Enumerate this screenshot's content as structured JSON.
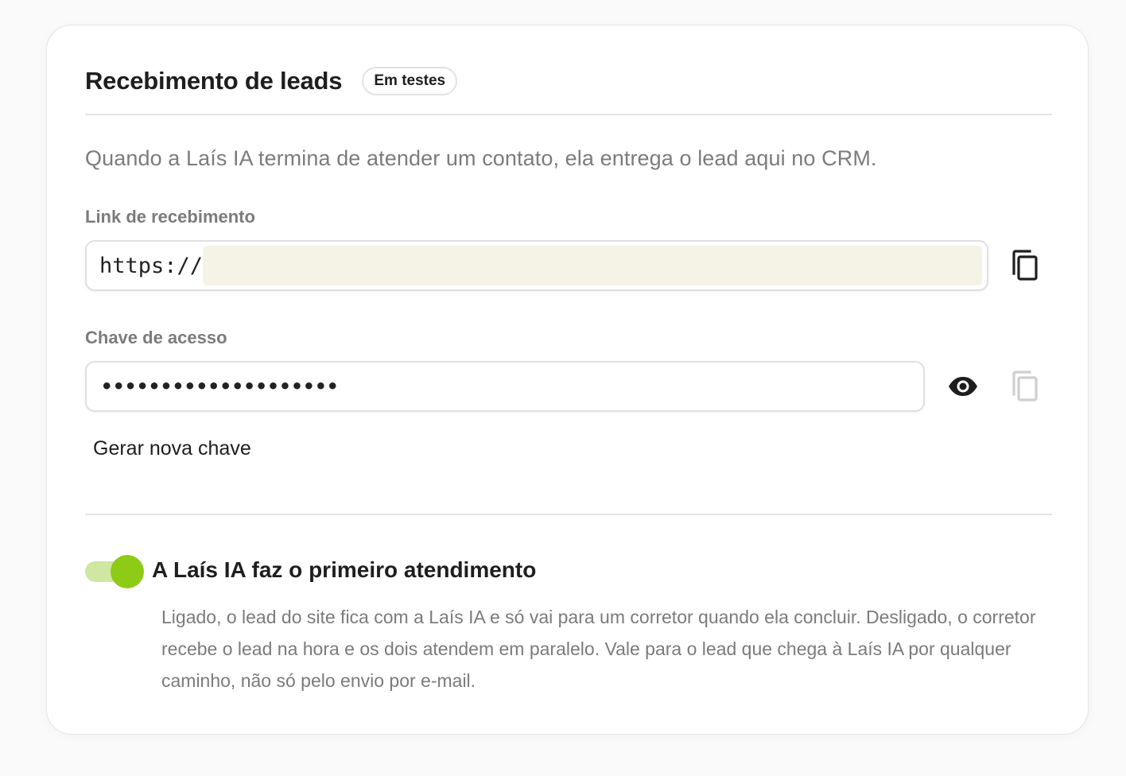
{
  "section": {
    "title": "Recebimento de leads",
    "badge": "Em testes",
    "description": "Quando a Laís IA termina de atender um contato, ela entrega o lead aqui no CRM."
  },
  "link_field": {
    "label": "Link de recebimento",
    "value_prefix": "https://",
    "copy_icon": "copy-icon"
  },
  "key_field": {
    "label": "Chave de acesso",
    "masked_value": "••••••••••••••••••••",
    "show_icon": "eye-icon",
    "copy_icon": "copy-icon",
    "copy_disabled": true
  },
  "actions": {
    "generate_key": "Gerar nova chave"
  },
  "ai_toggle": {
    "title": "A Laís IA faz o primeiro atendimento",
    "enabled": true,
    "description": "Ligado, o lead do site fica com a Laís IA e só vai para um corretor quando ela concluir. Desligado, o corretor recebe o lead na hora e os dois atendem em paralelo. Vale para o lead que chega à Laís IA por qualquer caminho, não só pelo envio por e-mail.",
    "colors": {
      "track": "#cfe7a0",
      "knob": "#8ecb17"
    }
  }
}
